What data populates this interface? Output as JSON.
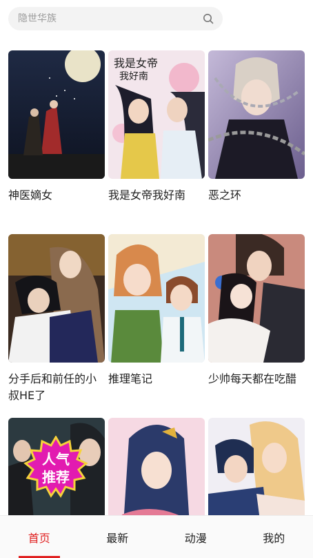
{
  "search": {
    "placeholder": "隐世华族"
  },
  "comics": [
    {
      "title": "神医嫡女",
      "cover_icon": "night-moon-couple-cover"
    },
    {
      "title": "我是女帝我好南",
      "cover_icon": "empress-couple-cover"
    },
    {
      "title": "恶之环",
      "cover_icon": "chained-boy-cover"
    },
    {
      "title": "分手后和前任的小叔HE了",
      "cover_icon": "embracing-couple-cover"
    },
    {
      "title": "推理笔记",
      "cover_icon": "detective-duo-cover"
    },
    {
      "title": "少帅每天都在吃醋",
      "cover_icon": "marshal-couple-cover"
    },
    {
      "title": "",
      "cover_icon": "group-cover",
      "badge": [
        "人气",
        "推荐"
      ]
    },
    {
      "title": "",
      "cover_icon": "princess-cover"
    },
    {
      "title": "",
      "cover_icon": "hug-couple-cover"
    }
  ],
  "tabs": [
    {
      "label": "首页",
      "active": true
    },
    {
      "label": "最新",
      "active": false
    },
    {
      "label": "动漫",
      "active": false
    },
    {
      "label": "我的",
      "active": false
    }
  ],
  "colors": {
    "accent": "#e02020",
    "badge": "#e21bb0",
    "search_bg": "#f3f3f3"
  }
}
